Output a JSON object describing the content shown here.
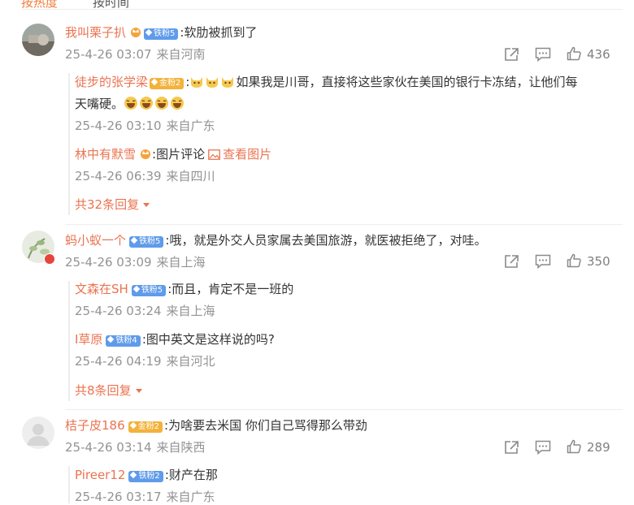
{
  "header_cut": {
    "sort_hot": "按热度",
    "sort_time": "按时间"
  },
  "comments": [
    {
      "user": "我叫栗子扒",
      "badge": "铁粉5",
      "text": ":软肋被抓到了",
      "date": "25-4-26 03:07",
      "location": "来自河南",
      "likes": "436",
      "replies": [
        {
          "user": "徒步的张学梁",
          "badge": "金粉2",
          "text_a": "如果我是川哥，直接将这些家伙在美国的银行卡冻结，让他们每",
          "text_b": "天嘴硬。",
          "date": "25-4-26 03:10",
          "location": "来自广东"
        },
        {
          "user": "林中有默雪",
          "text": ":图片评论",
          "link": "查看图片",
          "date": "25-4-26 06:39",
          "location": "来自四川"
        }
      ],
      "more": "共32条回复"
    },
    {
      "user": "蚂小蚁一个",
      "badge": "铁粉5",
      "text": ":哦，就是外交人员家属去美国旅游，就医被拒绝了，对哇。",
      "date": "25-4-26 03:09",
      "location": "来自上海",
      "likes": "350",
      "replies": [
        {
          "user": "文森在SH",
          "badge": "铁粉5",
          "text": ":而且，肯定不是一班的",
          "date": "25-4-26 03:24",
          "location": "来自上海"
        },
        {
          "user": "I草原",
          "badge": "铁粉4",
          "text": ":图中英文是这样说的吗?",
          "date": "25-4-26 04:19",
          "location": "来自河北"
        }
      ],
      "more": "共8条回复"
    },
    {
      "user": "桔子皮186",
      "badge": "金粉2",
      "text": ":为啥要去米国 你们自己骂得那么带劲",
      "date": "25-4-26 03:14",
      "location": "来自陕西",
      "likes": "289",
      "replies": [
        {
          "user": "Pireer12",
          "badge": "铁粉2",
          "text": ":财产在那",
          "date": "25-4-26 03:17",
          "location": "来自广东"
        }
      ]
    }
  ],
  "colors": {
    "username": "#eb7350",
    "meta": "#939393",
    "badge_iron": "#5f9bea",
    "badge_gold": "#f3b23b"
  }
}
